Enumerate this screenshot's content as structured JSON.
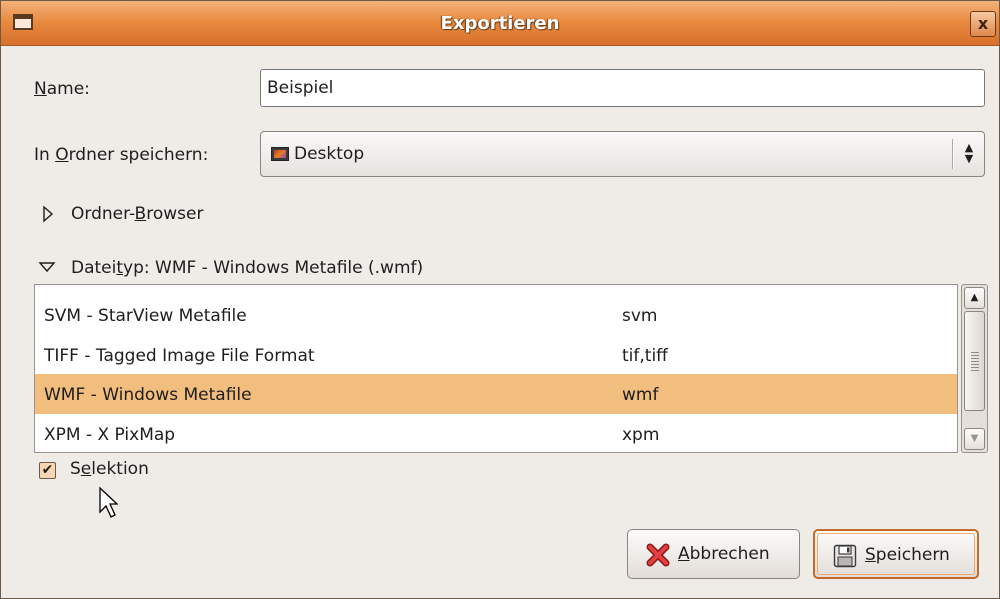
{
  "window": {
    "title": "Exportieren",
    "close_glyph": "x"
  },
  "name_field": {
    "label_pre": "",
    "label_mnemonic": "N",
    "label_post": "ame:",
    "value": "Beispiel"
  },
  "folder": {
    "label_pre": "In ",
    "label_mnemonic": "O",
    "label_post": "rdner speichern:",
    "value": "Desktop",
    "icon": "desktop-icon"
  },
  "browser_expander": {
    "label_pre": "Ordner-",
    "label_mnemonic": "B",
    "label_post": "rowser",
    "expanded": false
  },
  "filetype_expander": {
    "label_pre": "Datei",
    "label_mnemonic": "t",
    "label_post": "yp: WMF - Windows Metafile (.wmf)",
    "expanded": true
  },
  "filetypes": [
    {
      "name": "SVM - StarView Metafile",
      "ext": "svm",
      "selected": false
    },
    {
      "name": "TIFF - Tagged Image File Format",
      "ext": "tif,tiff",
      "selected": false
    },
    {
      "name": "WMF - Windows Metafile",
      "ext": "wmf",
      "selected": true
    },
    {
      "name": "XPM - X PixMap",
      "ext": "xpm",
      "selected": false
    }
  ],
  "selection_checkbox": {
    "label_pre": "S",
    "label_mnemonic": "e",
    "label_post": "lektion",
    "checked": true
  },
  "buttons": {
    "cancel": {
      "label_pre": "",
      "label_mnemonic": "A",
      "label_post": "bbrechen",
      "icon": "cancel-x-icon"
    },
    "save": {
      "label_pre": "",
      "label_mnemonic": "S",
      "label_post": "peichern",
      "icon": "floppy-disk-icon"
    }
  },
  "colors": {
    "titlebar": "#e98b41",
    "selection": "#f2be7e",
    "accent": "#c56a2a"
  }
}
